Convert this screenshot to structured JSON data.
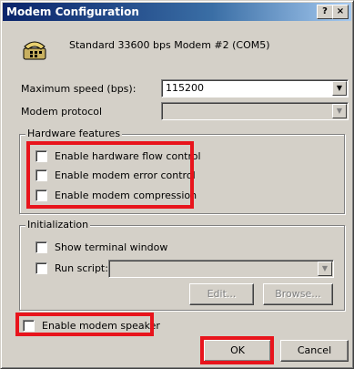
{
  "window": {
    "title": "Modem Configuration",
    "help_label": "?",
    "close_label": "×",
    "header": "Standard 33600 bps Modem #2 (COM5)"
  },
  "fields": {
    "max_speed_label": "Maximum speed (bps):",
    "max_speed_value": "115200",
    "protocol_label": "Modem protocol",
    "protocol_value": ""
  },
  "hardware": {
    "title": "Hardware features",
    "flow_control": "Enable hardware flow control",
    "error_control": "Enable modem error control",
    "compression": "Enable modem compression"
  },
  "init": {
    "title": "Initialization",
    "show_terminal": "Show terminal window",
    "run_script": "Run script:",
    "edit": "Edit...",
    "browse": "Browse..."
  },
  "speaker": "Enable modem speaker",
  "buttons": {
    "ok": "OK",
    "cancel": "Cancel"
  },
  "icons": {
    "modem": "modem-telephone-icon",
    "dropdown": "chevron-down-icon"
  },
  "colors": {
    "highlight": "#e8141c",
    "titlebar": "#0a246a"
  }
}
